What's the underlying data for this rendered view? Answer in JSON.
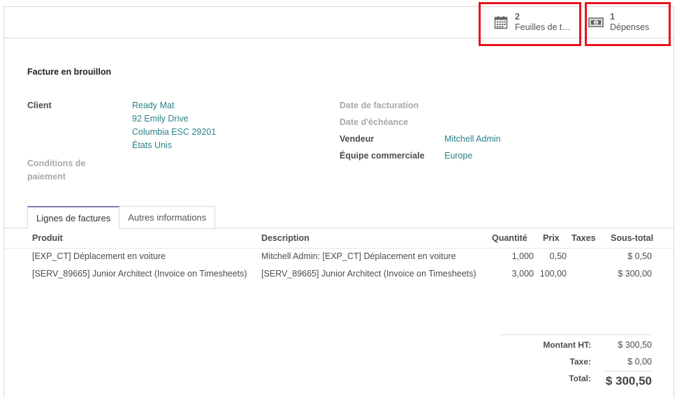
{
  "smart_buttons": [
    {
      "count": "2",
      "label": "Feuilles de t…",
      "icon": "calendar-icon"
    },
    {
      "count": "1",
      "label": "Dépenses",
      "icon": "money-icon"
    }
  ],
  "highlight_color": "#e8141b",
  "invoice": {
    "title": "Facture en brouillon",
    "client_label": "Client",
    "client_lines": [
      "Ready Mat",
      "92 Emily Drive",
      "Columbia ESC 29201",
      "États Unis"
    ],
    "payment_terms_label": "Conditions de paiement",
    "invoice_date_label": "Date de facturation",
    "due_date_label": "Date d'échéance",
    "salesperson_label": "Vendeur",
    "salesperson": "Mitchell Admin",
    "sales_team_label": "Équipe commerciale",
    "sales_team": "Europe"
  },
  "tabs": [
    "Lignes de factures",
    "Autres informations"
  ],
  "table": {
    "headers": {
      "product": "Produit",
      "description": "Description",
      "quantity": "Quantité",
      "price": "Prix",
      "taxes": "Taxes",
      "subtotal": "Sous-total"
    },
    "rows": [
      {
        "product": "[EXP_CT] Déplacement en voiture",
        "description": "Mitchell Admin: [EXP_CT] Déplacement en voiture",
        "quantity": "1,000",
        "price": "0,50",
        "taxes": "",
        "subtotal": "$ 0,50"
      },
      {
        "product": "[SERV_89665] Junior Architect (Invoice on Timesheets)",
        "description": "[SERV_89665] Junior Architect (Invoice on Timesheets)",
        "quantity": "3,000",
        "price": "100,00",
        "taxes": "",
        "subtotal": "$ 300,00"
      }
    ]
  },
  "totals": {
    "untaxed_label": "Montant HT:",
    "untaxed": "$ 300,50",
    "tax_label": "Taxe:",
    "tax": "$ 0,00",
    "total_label": "Total:",
    "total": "$ 300,50"
  },
  "colors": {
    "link": "#2a8187",
    "muted_label": "#a8a8a8",
    "tab_accent": "#7c7bad"
  }
}
